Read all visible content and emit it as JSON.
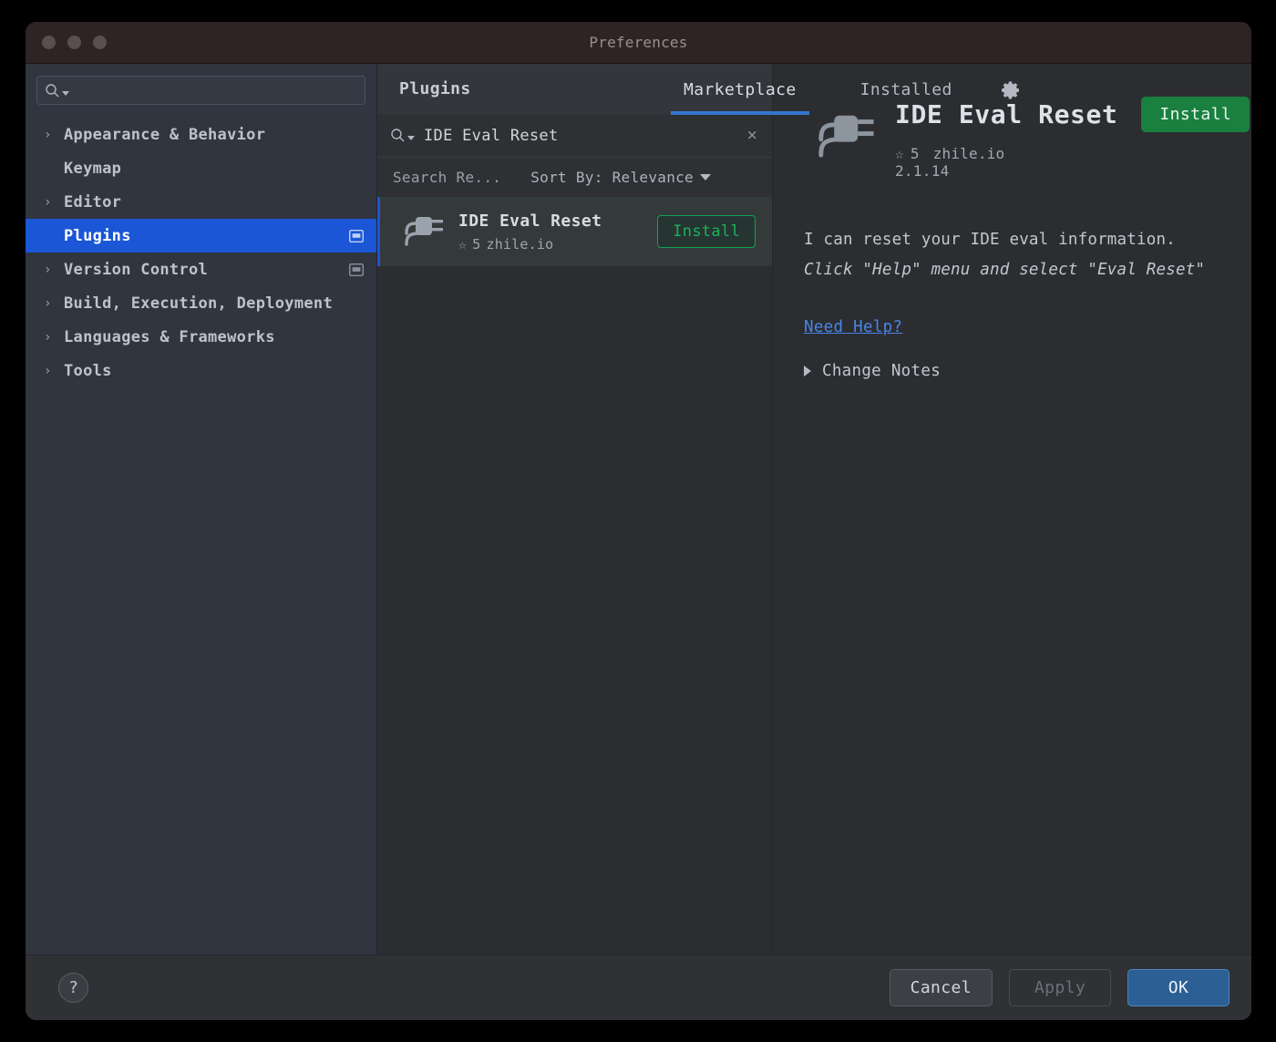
{
  "window": {
    "title": "Preferences",
    "traffic_lights": [
      "close-dot",
      "minimize-dot",
      "zoom-dot"
    ]
  },
  "sidebar": {
    "search": {
      "placeholder": "",
      "value": "",
      "icon": "search-icon"
    },
    "items": [
      {
        "label": "Appearance & Behavior",
        "arrow": "›",
        "expandable": true,
        "selected": false,
        "badge": false
      },
      {
        "label": "Keymap",
        "arrow": "",
        "expandable": false,
        "selected": false,
        "badge": false
      },
      {
        "label": "Editor",
        "arrow": "›",
        "expandable": true,
        "selected": false,
        "badge": false
      },
      {
        "label": "Plugins",
        "arrow": "",
        "expandable": false,
        "selected": true,
        "badge": true
      },
      {
        "label": "Version Control",
        "arrow": "›",
        "expandable": true,
        "selected": false,
        "badge": true
      },
      {
        "label": "Build, Execution, Deployment",
        "arrow": "›",
        "expandable": true,
        "selected": false,
        "badge": false
      },
      {
        "label": "Languages & Frameworks",
        "arrow": "›",
        "expandable": true,
        "selected": false,
        "badge": false
      },
      {
        "label": "Tools",
        "arrow": "›",
        "expandable": true,
        "selected": false,
        "badge": false
      }
    ]
  },
  "plugins": {
    "header_title": "Plugins",
    "tabs": [
      {
        "label": "Marketplace",
        "active": true
      },
      {
        "label": "Installed",
        "active": false
      }
    ],
    "settings_icon": "gear-icon",
    "search": {
      "value": "IDE Eval Reset",
      "icon": "search-icon",
      "clear_icon": "×"
    },
    "toolbar": {
      "results_label": "Search Re...",
      "sort_label": "Sort By: Relevance"
    },
    "results": [
      {
        "name": "IDE Eval Reset",
        "rating_star": "☆",
        "rating": "5",
        "vendor": "zhile.io",
        "install_label": "Install",
        "selected": true
      }
    ]
  },
  "detail": {
    "icon": "plug-icon",
    "title": "IDE Eval Reset",
    "install_label": "Install",
    "rating_star": "☆",
    "rating": "5",
    "vendor": "zhile.io",
    "version": "2.1.14",
    "description_line1": "I can reset your IDE eval information.",
    "description_italic": "Click \"Help\" menu and select \"Eval Reset\"",
    "need_help_label": "Need Help?",
    "change_notes_label": "Change Notes"
  },
  "footer": {
    "help_label": "?",
    "cancel_label": "Cancel",
    "apply_label": "Apply",
    "ok_label": "OK"
  },
  "colors": {
    "accent_blue": "#1a56d6",
    "tab_underline": "#3577cf",
    "install_green": "#19803f",
    "install_outline_green": "#12a150",
    "link_blue": "#4a86e8",
    "ok_blue": "#2c5f94",
    "sidebar_bg": "#31353f",
    "panel_bg": "#2b2d31",
    "titlebar_bg": "#2e2424"
  }
}
